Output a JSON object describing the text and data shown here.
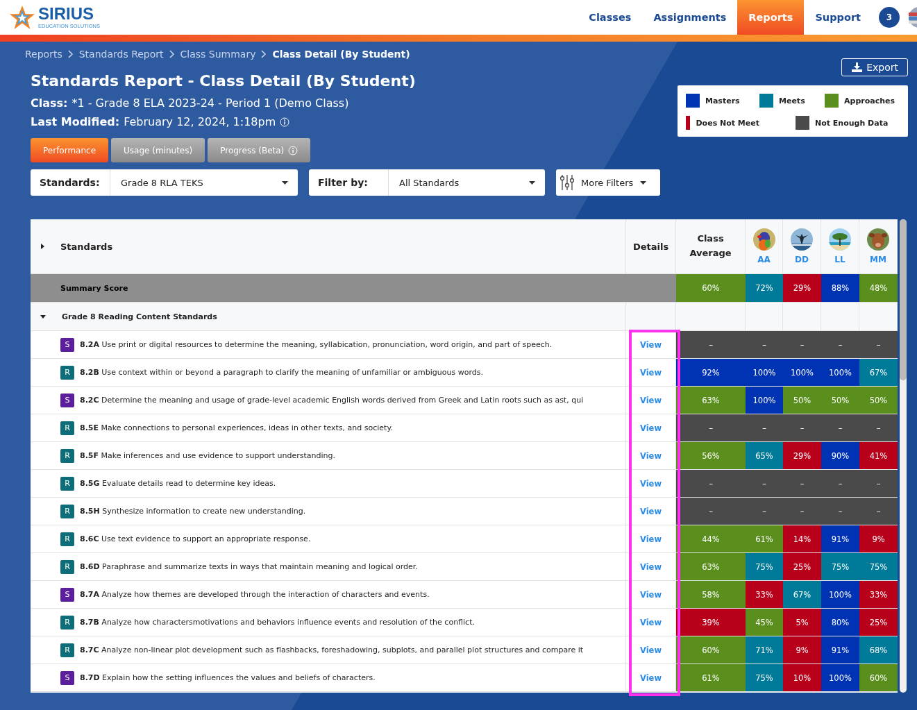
{
  "brand": {
    "name": "SIRIUS",
    "tagline": "EDUCATION SOLUTIONS"
  },
  "nav": [
    {
      "label": "Classes",
      "selected": false
    },
    {
      "label": "Assignments",
      "selected": false
    },
    {
      "label": "Reports",
      "selected": true
    },
    {
      "label": "Support",
      "selected": false
    }
  ],
  "notification_count": "3",
  "breadcrumbs": [
    {
      "label": "Reports",
      "current": false
    },
    {
      "label": "Standards Report",
      "current": false
    },
    {
      "label": "Class Summary",
      "current": false
    },
    {
      "label": "Class Detail (By Student)",
      "current": true
    }
  ],
  "title": "Standards Report - Class Detail (By Student)",
  "class_info": {
    "label": "Class:",
    "value": "*1 - Grade 8 ELA 2023-24 - Period 1 (Demo Class)"
  },
  "modified_info": {
    "label": "Last Modified:",
    "value": "February 12, 2024, 1:18pm"
  },
  "export_button": "Export",
  "legend": [
    {
      "label": "Masters",
      "color": "#0033b3"
    },
    {
      "label": "Meets",
      "color": "#007a99"
    },
    {
      "label": "Approaches",
      "color": "#5a8f1e"
    },
    {
      "label": "Does Not Meet",
      "color": "#b8001a"
    },
    {
      "label": "Not Enough Data",
      "color": "#4a4a4a"
    }
  ],
  "view_tabs": [
    {
      "label": "Performance",
      "selected": true,
      "info": false
    },
    {
      "label": "Usage (minutes)",
      "selected": false,
      "info": false
    },
    {
      "label": "Progress (Beta)",
      "selected": false,
      "info": true
    }
  ],
  "filters": [
    {
      "label": "Standards:",
      "value": "Grade 8 RLA TEKS"
    },
    {
      "label": "Filter by:",
      "value": "All Standards"
    }
  ],
  "more_filters": "More Filters",
  "table": {
    "standards_header": "Standards",
    "details_header": "Details",
    "average_header": "Class Average",
    "students": [
      {
        "initials": "AA"
      },
      {
        "initials": "DD"
      },
      {
        "initials": "LL"
      },
      {
        "initials": "MM"
      }
    ],
    "summary": {
      "label": "Summary Score",
      "cells": [
        {
          "text": "60%",
          "color": "#5a8f1e"
        },
        {
          "text": "72%",
          "color": "#007a99"
        },
        {
          "text": "29%",
          "color": "#b8001a"
        },
        {
          "text": "88%",
          "color": "#0033b3"
        },
        {
          "text": "48%",
          "color": "#5a8f1e"
        }
      ]
    },
    "group": {
      "label": "Grade 8 Reading Content Standards",
      "expanded": true
    },
    "details_highlighted": true,
    "rows": [
      {
        "type": "S",
        "code": "8.2A",
        "text": "Use print or digital resources to determine the meaning, syllabication, pronunciation, word origin, and part of speech.",
        "link": "View",
        "cells": [
          {
            "text": "–",
            "color": "#4a4a4a"
          },
          {
            "text": "–",
            "color": "#4a4a4a"
          },
          {
            "text": "–",
            "color": "#4a4a4a"
          },
          {
            "text": "–",
            "color": "#4a4a4a"
          },
          {
            "text": "–",
            "color": "#4a4a4a"
          }
        ]
      },
      {
        "type": "R",
        "code": "8.2B",
        "text": "Use context within or beyond a paragraph to clarify the meaning of unfamiliar or ambiguous words.",
        "link": "View",
        "cells": [
          {
            "text": "92%",
            "color": "#0033b3"
          },
          {
            "text": "100%",
            "color": "#0033b3"
          },
          {
            "text": "100%",
            "color": "#0033b3"
          },
          {
            "text": "100%",
            "color": "#0033b3"
          },
          {
            "text": "67%",
            "color": "#007a99"
          }
        ]
      },
      {
        "type": "S",
        "code": "8.2C",
        "text": "Determine the meaning and usage of grade-level academic English words derived from Greek and Latin roots such as ast, qui",
        "link": "View",
        "cells": [
          {
            "text": "63%",
            "color": "#5a8f1e"
          },
          {
            "text": "100%",
            "color": "#0033b3"
          },
          {
            "text": "50%",
            "color": "#5a8f1e"
          },
          {
            "text": "50%",
            "color": "#5a8f1e"
          },
          {
            "text": "50%",
            "color": "#5a8f1e"
          }
        ]
      },
      {
        "type": "R",
        "code": "8.5E",
        "text": "Make connections to personal experiences, ideas in other texts, and society.",
        "link": "View",
        "cells": [
          {
            "text": "–",
            "color": "#4a4a4a"
          },
          {
            "text": "–",
            "color": "#4a4a4a"
          },
          {
            "text": "–",
            "color": "#4a4a4a"
          },
          {
            "text": "–",
            "color": "#4a4a4a"
          },
          {
            "text": "–",
            "color": "#4a4a4a"
          }
        ]
      },
      {
        "type": "R",
        "code": "8.5F",
        "text": "Make inferences and use evidence to support understanding.",
        "link": "View",
        "cells": [
          {
            "text": "56%",
            "color": "#5a8f1e"
          },
          {
            "text": "65%",
            "color": "#007a99"
          },
          {
            "text": "29%",
            "color": "#b8001a"
          },
          {
            "text": "90%",
            "color": "#0033b3"
          },
          {
            "text": "41%",
            "color": "#b8001a"
          }
        ]
      },
      {
        "type": "R",
        "code": "8.5G",
        "text": "Evaluate details read to determine key ideas.",
        "link": "View",
        "cells": [
          {
            "text": "–",
            "color": "#4a4a4a"
          },
          {
            "text": "–",
            "color": "#4a4a4a"
          },
          {
            "text": "–",
            "color": "#4a4a4a"
          },
          {
            "text": "–",
            "color": "#4a4a4a"
          },
          {
            "text": "–",
            "color": "#4a4a4a"
          }
        ]
      },
      {
        "type": "R",
        "code": "8.5H",
        "text": "Synthesize information to create new understanding.",
        "link": "View",
        "cells": [
          {
            "text": "–",
            "color": "#4a4a4a"
          },
          {
            "text": "–",
            "color": "#4a4a4a"
          },
          {
            "text": "–",
            "color": "#4a4a4a"
          },
          {
            "text": "–",
            "color": "#4a4a4a"
          },
          {
            "text": "–",
            "color": "#4a4a4a"
          }
        ]
      },
      {
        "type": "R",
        "code": "8.6C",
        "text": "Use text evidence to support an appropriate response.",
        "link": "View",
        "cells": [
          {
            "text": "44%",
            "color": "#5a8f1e"
          },
          {
            "text": "61%",
            "color": "#5a8f1e"
          },
          {
            "text": "14%",
            "color": "#b8001a"
          },
          {
            "text": "91%",
            "color": "#0033b3"
          },
          {
            "text": "9%",
            "color": "#b8001a"
          }
        ]
      },
      {
        "type": "R",
        "code": "8.6D",
        "text": "Paraphrase and summarize texts in ways that maintain meaning and logical order.",
        "link": "View",
        "cells": [
          {
            "text": "63%",
            "color": "#5a8f1e"
          },
          {
            "text": "75%",
            "color": "#007a99"
          },
          {
            "text": "25%",
            "color": "#b8001a"
          },
          {
            "text": "75%",
            "color": "#007a99"
          },
          {
            "text": "75%",
            "color": "#007a99"
          }
        ]
      },
      {
        "type": "S",
        "code": "8.7A",
        "text": "Analyze how themes are developed through the interaction of characters and events.",
        "link": "View",
        "cells": [
          {
            "text": "58%",
            "color": "#5a8f1e"
          },
          {
            "text": "33%",
            "color": "#b8001a"
          },
          {
            "text": "67%",
            "color": "#007a99"
          },
          {
            "text": "100%",
            "color": "#0033b3"
          },
          {
            "text": "33%",
            "color": "#b8001a"
          }
        ]
      },
      {
        "type": "R",
        "code": "8.7B",
        "text": "Analyze how charactersmotivations and behaviors influence events and resolution of the conflict.",
        "link": "View",
        "cells": [
          {
            "text": "39%",
            "color": "#b8001a"
          },
          {
            "text": "45%",
            "color": "#5a8f1e"
          },
          {
            "text": "5%",
            "color": "#b8001a"
          },
          {
            "text": "80%",
            "color": "#0033b3"
          },
          {
            "text": "25%",
            "color": "#b8001a"
          }
        ]
      },
      {
        "type": "R",
        "code": "8.7C",
        "text": "Analyze non-linear plot development such as flashbacks, foreshadowing, subplots, and parallel plot structures and compare it",
        "link": "View",
        "cells": [
          {
            "text": "60%",
            "color": "#5a8f1e"
          },
          {
            "text": "71%",
            "color": "#007a99"
          },
          {
            "text": "9%",
            "color": "#b8001a"
          },
          {
            "text": "91%",
            "color": "#0033b3"
          },
          {
            "text": "68%",
            "color": "#007a99"
          }
        ]
      },
      {
        "type": "S",
        "code": "8.7D",
        "text": "Explain how the setting influences the values and beliefs of characters.",
        "link": "View",
        "cells": [
          {
            "text": "61%",
            "color": "#5a8f1e"
          },
          {
            "text": "75%",
            "color": "#007a99"
          },
          {
            "text": "10%",
            "color": "#b8001a"
          },
          {
            "text": "100%",
            "color": "#0033b3"
          },
          {
            "text": "60%",
            "color": "#5a8f1e"
          }
        ]
      }
    ]
  }
}
